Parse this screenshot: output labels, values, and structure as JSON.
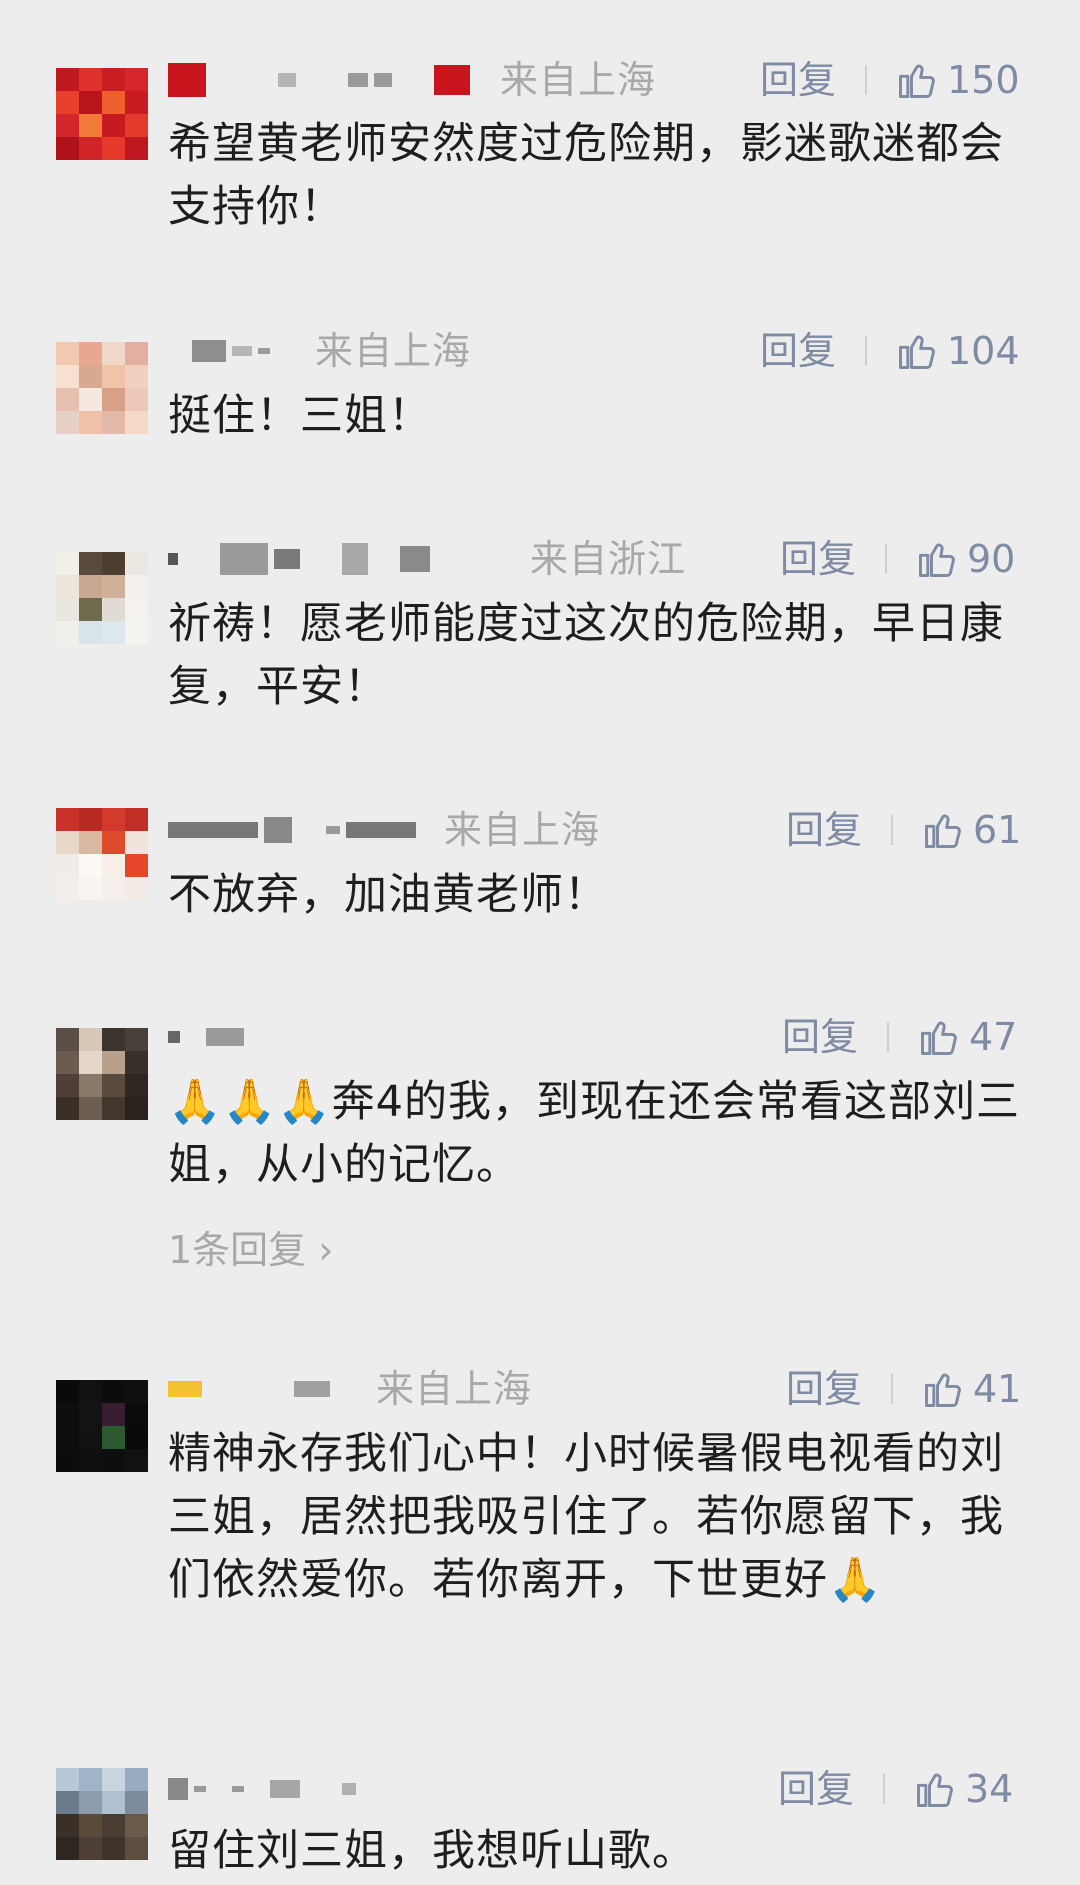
{
  "ui": {
    "reply_label": "回复",
    "accent_color": "#7f8aa3",
    "region_color": "#a8a8a8",
    "like_icon": "thumbs-up-icon"
  },
  "comments": [
    {
      "region": "来自上海",
      "likes": "150",
      "text": "希望黄老师安然度过危险期，影迷歌迷都会支持你！"
    },
    {
      "region": "来自上海",
      "likes": "104",
      "text": "挺住！三姐！"
    },
    {
      "region": "来自浙江",
      "likes": "90",
      "text": "祈祷！愿老师能度过这次的危险期，早日康复，平安！"
    },
    {
      "region": "来自上海",
      "likes": "61",
      "text": "不放弃，加油黄老师！"
    },
    {
      "region": "",
      "likes": "47",
      "text": "🙏🙏🙏奔4的我，到现在还会常看这部刘三姐，从小的记忆。",
      "sub_replies": "1条回复 ›"
    },
    {
      "region": "来自上海",
      "likes": "41",
      "text": "精神永存我们心中！小时候暑假电视看的刘三姐，居然把我吸引住了。若你愿留下，我们依然爱你。若你离开，下世更好🙏"
    },
    {
      "region": "",
      "likes": "34",
      "text": "留住刘三姐，我想听山歌。"
    }
  ]
}
